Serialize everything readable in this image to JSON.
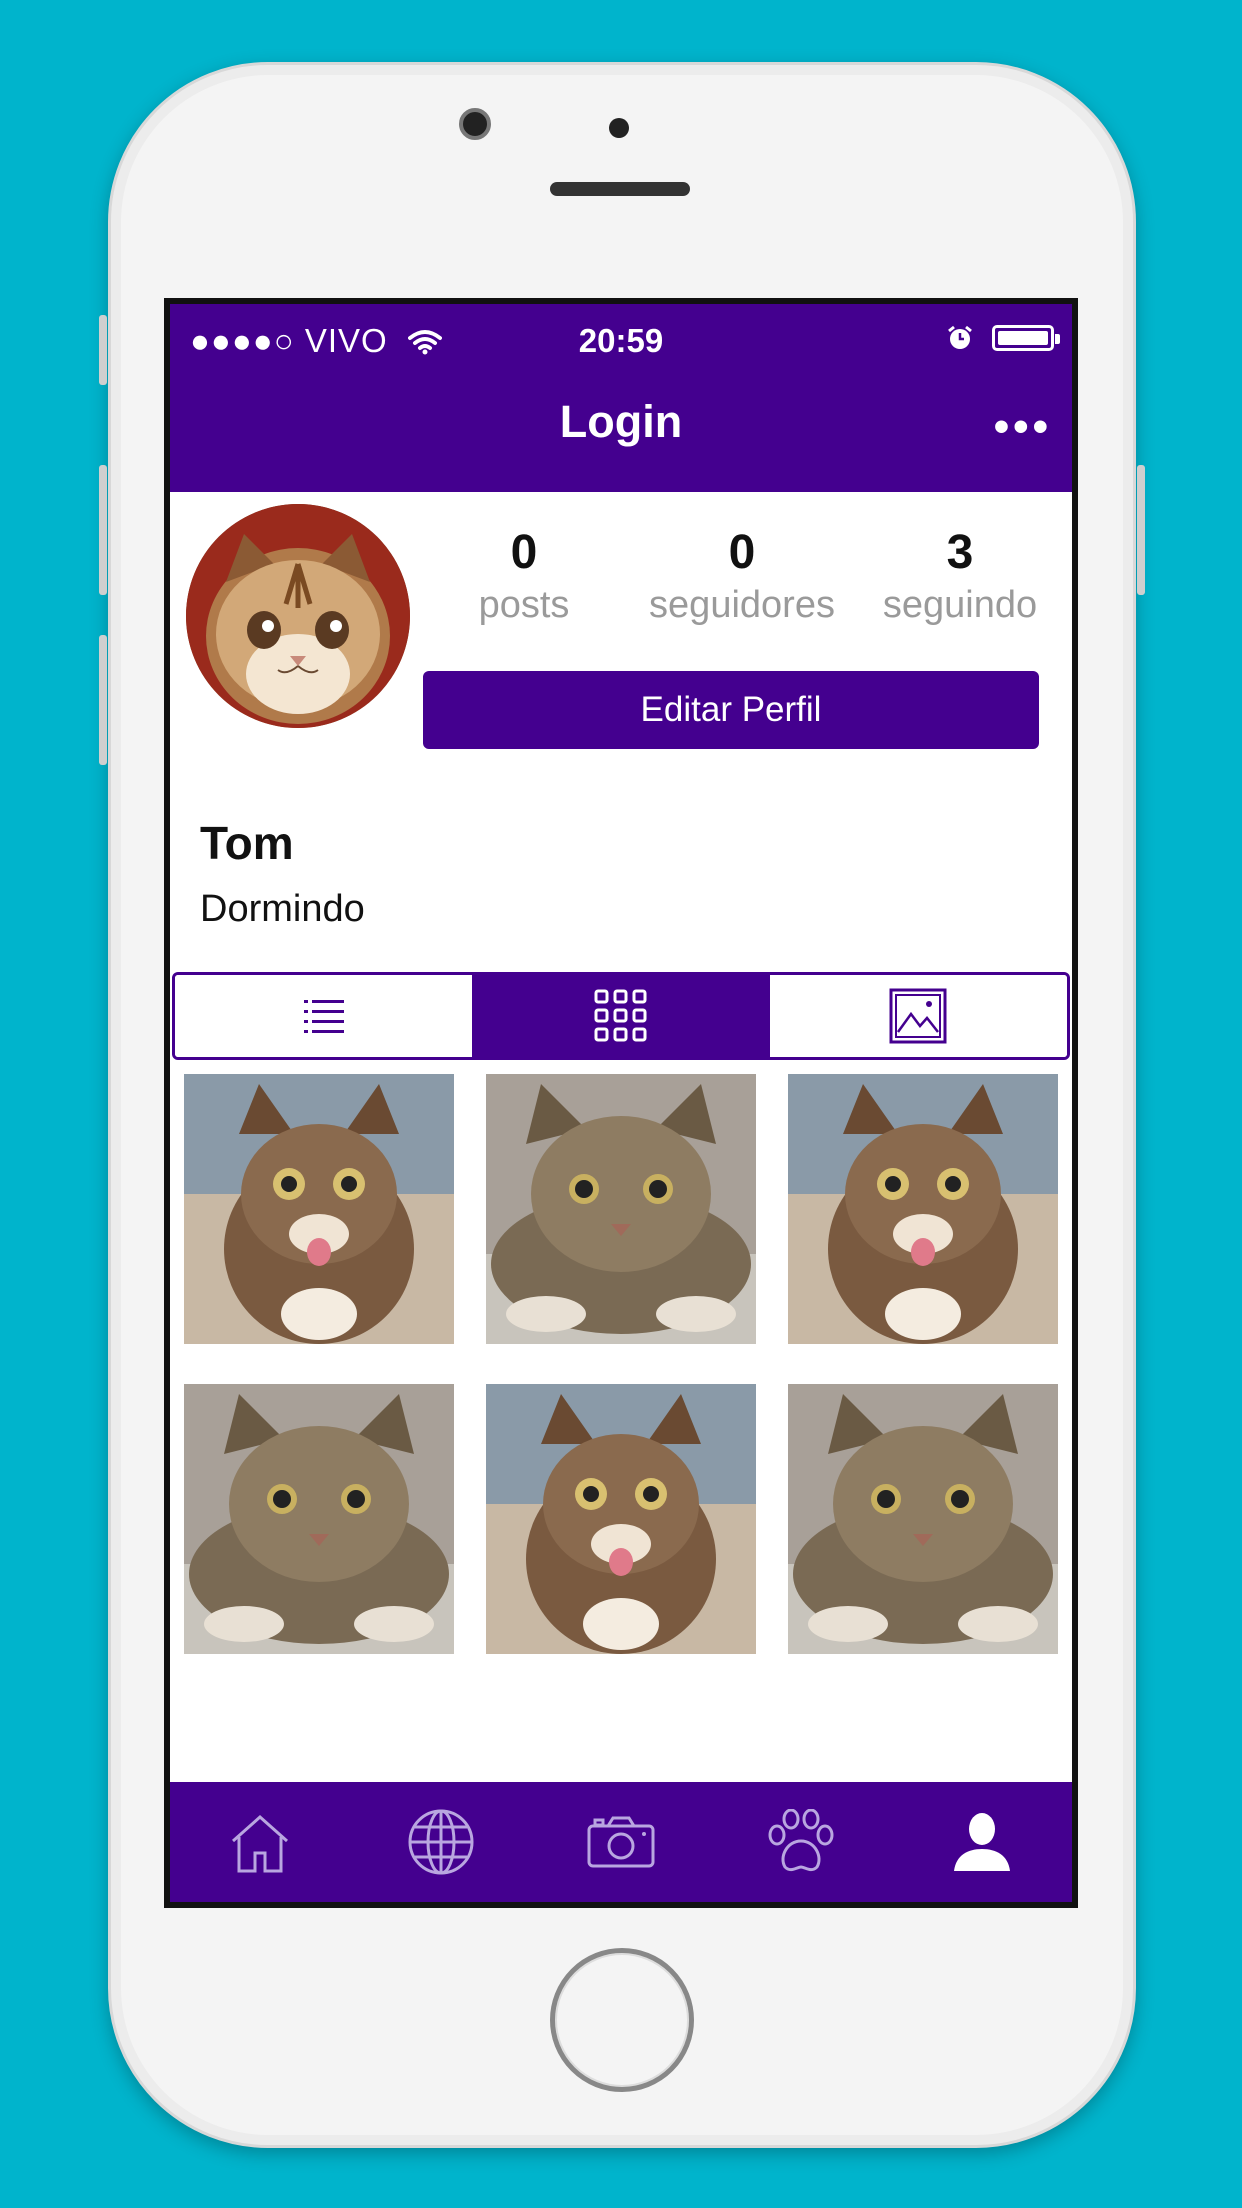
{
  "status_bar": {
    "carrier": "●●●●○ VIVO",
    "time": "20:59"
  },
  "header": {
    "title": "Login",
    "more": "•••"
  },
  "profile": {
    "stats": [
      {
        "value": "0",
        "label": "posts"
      },
      {
        "value": "0",
        "label": "seguidores"
      },
      {
        "value": "3",
        "label": "seguindo"
      }
    ],
    "edit_label": "Editar Perfil",
    "name": "Tom",
    "bio": "Dormindo"
  },
  "view_tabs": [
    {
      "icon": "list-icon",
      "active": false
    },
    {
      "icon": "grid-icon",
      "active": true
    },
    {
      "icon": "image-icon",
      "active": false
    }
  ],
  "photos": [
    {
      "kind": "kitten-tongue"
    },
    {
      "kind": "tabby-lying"
    },
    {
      "kind": "kitten-tongue"
    },
    {
      "kind": "tabby-lying"
    },
    {
      "kind": "kitten-tongue"
    },
    {
      "kind": "tabby-lying"
    }
  ],
  "bottom_nav": [
    {
      "icon": "home-icon",
      "active": false
    },
    {
      "icon": "globe-icon",
      "active": false
    },
    {
      "icon": "camera-icon",
      "active": false
    },
    {
      "icon": "paw-icon",
      "active": false
    },
    {
      "icon": "user-icon",
      "active": true
    }
  ],
  "colors": {
    "brand": "#44008F",
    "background": "#00B4CC",
    "muted_text": "#9a9a9a"
  }
}
